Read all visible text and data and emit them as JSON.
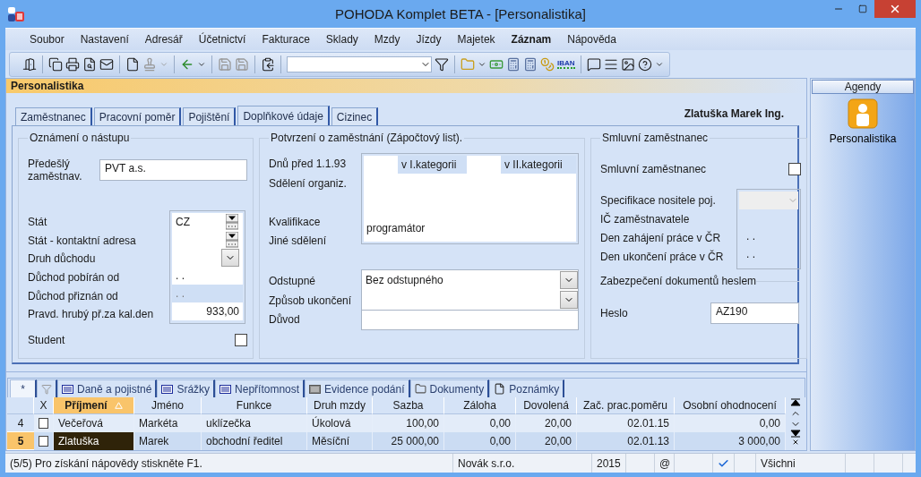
{
  "window": {
    "title": "POHODA Komplet BETA - [Personalistika]"
  },
  "menu": [
    {
      "label": "Soubor",
      "bold": false
    },
    {
      "label": "Nastavení",
      "bold": false
    },
    {
      "label": "Adresář",
      "bold": false
    },
    {
      "label": "Účetnictví",
      "bold": false
    },
    {
      "label": "Fakturace",
      "bold": false
    },
    {
      "label": "Sklady",
      "bold": false
    },
    {
      "label": "Mzdy",
      "bold": false
    },
    {
      "label": "Jízdy",
      "bold": false
    },
    {
      "label": "Majetek",
      "bold": false
    },
    {
      "label": "Záznam",
      "bold": true
    },
    {
      "label": "Nápověda",
      "bold": false
    }
  ],
  "toolbar": {
    "iban": "IBAN"
  },
  "agenda": {
    "title": "Personalistika",
    "employee": "Zlatuška Marek Ing."
  },
  "tabs": [
    {
      "label": "Zaměstnanec",
      "selected": false
    },
    {
      "label": "Pracovní poměr",
      "selected": false
    },
    {
      "label": "Pojištění",
      "selected": false
    },
    {
      "label": "Doplňkové údaje",
      "selected": true
    },
    {
      "label": "Cizinec",
      "selected": false
    }
  ],
  "notice": {
    "title": "Oznámení o nástupu",
    "previous_employer": {
      "label": "Předešlý zaměstnav.",
      "value": "PVT a.s."
    },
    "fields": [
      {
        "label": "Stát",
        "value": "CZ",
        "kind": "lookup"
      },
      {
        "label": "Stát - kontaktní adresa",
        "kind": "lookup"
      },
      {
        "label": "Druh důchodu",
        "kind": "combo"
      },
      {
        "label": "Důchod pobírán od",
        "value": ". .",
        "kind": "date"
      },
      {
        "label": "Důchod přiznán od",
        "value": ". .",
        "kind": "shaded"
      },
      {
        "label": "Pravd. hrubý př.za kal.den",
        "value": "933,00",
        "kind": "number"
      }
    ],
    "student": {
      "label": "Student",
      "checked": false
    }
  },
  "confirmation": {
    "title": "Potvrzení o zaměstnání (Zápočtový list).",
    "days_label": "Dnů před 1.1.93",
    "category_1": "v I.kategorii",
    "category_2": "v II.kategorii",
    "organization_label": "Sdělení organiz.",
    "qualification_label": "Kvalifikace",
    "qualification": "programátor",
    "other_label": "Jiné sdělení",
    "severance_label": "Odstupné",
    "severance": "Bez odstupného",
    "termination_label": "Způsob ukončení",
    "reason_label": "Důvod"
  },
  "contract": {
    "title": "Smluvní zaměstnanec",
    "checkbox": {
      "label": "Smluvní zaměstnanec",
      "checked": false
    },
    "fields": [
      {
        "label": "Specifikace nositele poj.",
        "kind": "combo"
      },
      {
        "label": "IČ zaměstnavatele",
        "kind": "text"
      },
      {
        "label": "Den zahájení práce v ČR",
        "value": ". .",
        "kind": "date"
      },
      {
        "label": "Den ukončení práce v ČR",
        "value": ". .",
        "kind": "date"
      }
    ]
  },
  "security": {
    "title": "Zabezpečení dokumentů heslem",
    "label": "Heslo",
    "value": "AZ190"
  },
  "bottom_tabs": [
    {
      "label": "*",
      "kind": "star",
      "selected": true
    },
    {
      "kind": "filter",
      "selected": false
    },
    {
      "label": "Daně a pojistné",
      "kind": "list",
      "selected": false
    },
    {
      "label": "Srážky",
      "kind": "list",
      "selected": false
    },
    {
      "label": "Nepřítomnost",
      "kind": "list",
      "selected": false
    },
    {
      "label": "Evidence podání",
      "kind": "grey",
      "selected": false
    },
    {
      "label": "Dokumenty",
      "kind": "folder",
      "selected": false
    },
    {
      "label": "Poznámky",
      "kind": "note",
      "selected": false
    }
  ],
  "table": {
    "columns": [
      {
        "sorted": false
      },
      {
        "label": "X",
        "sorted": false
      },
      {
        "label": "Příjmení",
        "sorted": true
      },
      {
        "label": "Jméno",
        "sorted": false
      },
      {
        "label": "Funkce",
        "sorted": false
      },
      {
        "label": "Druh mzdy",
        "sorted": false
      },
      {
        "label": "Sazba",
        "sorted": false
      },
      {
        "label": "Záloha",
        "sorted": false
      },
      {
        "label": "Dovolená",
        "sorted": false
      },
      {
        "label": "Zač. prac.poměru",
        "sorted": false
      },
      {
        "label": "Osobní ohodnocení",
        "sorted": false
      }
    ],
    "rows": [
      {
        "selected": false,
        "checked": false,
        "cells": [
          "4",
          "",
          "Večeřová",
          "Markéta",
          "uklízečka",
          "Úkolová",
          "100,00",
          "0,00",
          "20,00",
          "02.01.15",
          "0,00"
        ]
      },
      {
        "selected": true,
        "checked": false,
        "cells": [
          "5",
          "",
          "Zlatuška",
          "Marek",
          "obchodní ředitel",
          "Měsíční",
          "25 000,00",
          "0,00",
          "20,00",
          "02.01.13",
          "3 000,00"
        ]
      }
    ]
  },
  "sidebar": {
    "title": "Agendy",
    "items": [
      {
        "label": "Personalistika"
      }
    ]
  },
  "status_bar": {
    "message": "(5/5) Pro získání nápovědy stiskněte F1.",
    "company": "Novák s.r.o.",
    "year": "2015",
    "mail": "@",
    "filter": "Všichni"
  }
}
